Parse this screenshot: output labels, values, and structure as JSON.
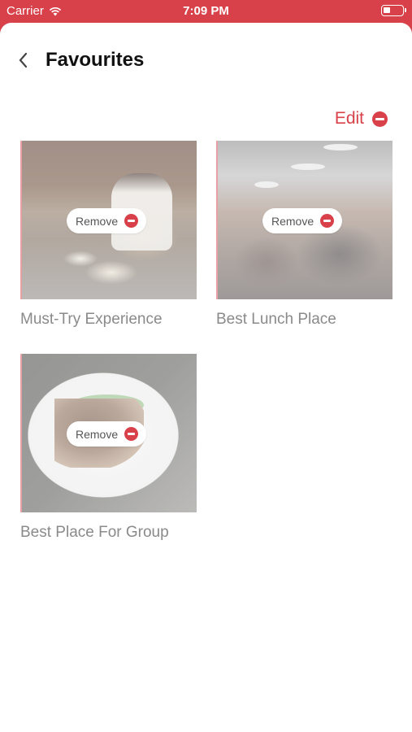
{
  "status_bar": {
    "carrier": "Carrier",
    "time": "7:09 PM"
  },
  "header": {
    "title": "Favourites",
    "back_icon": "chevron-left-icon"
  },
  "edit": {
    "label": "Edit",
    "icon": "minus-circle-icon"
  },
  "favourites": [
    {
      "name": "Must-Try Experience",
      "remove_label": "Remove"
    },
    {
      "name": "Best Lunch Place",
      "remove_label": "Remove"
    },
    {
      "name": "Best Place For Group",
      "remove_label": "Remove"
    }
  ],
  "colors": {
    "accent": "#d9414a",
    "label_text": "#8a8a8a"
  }
}
